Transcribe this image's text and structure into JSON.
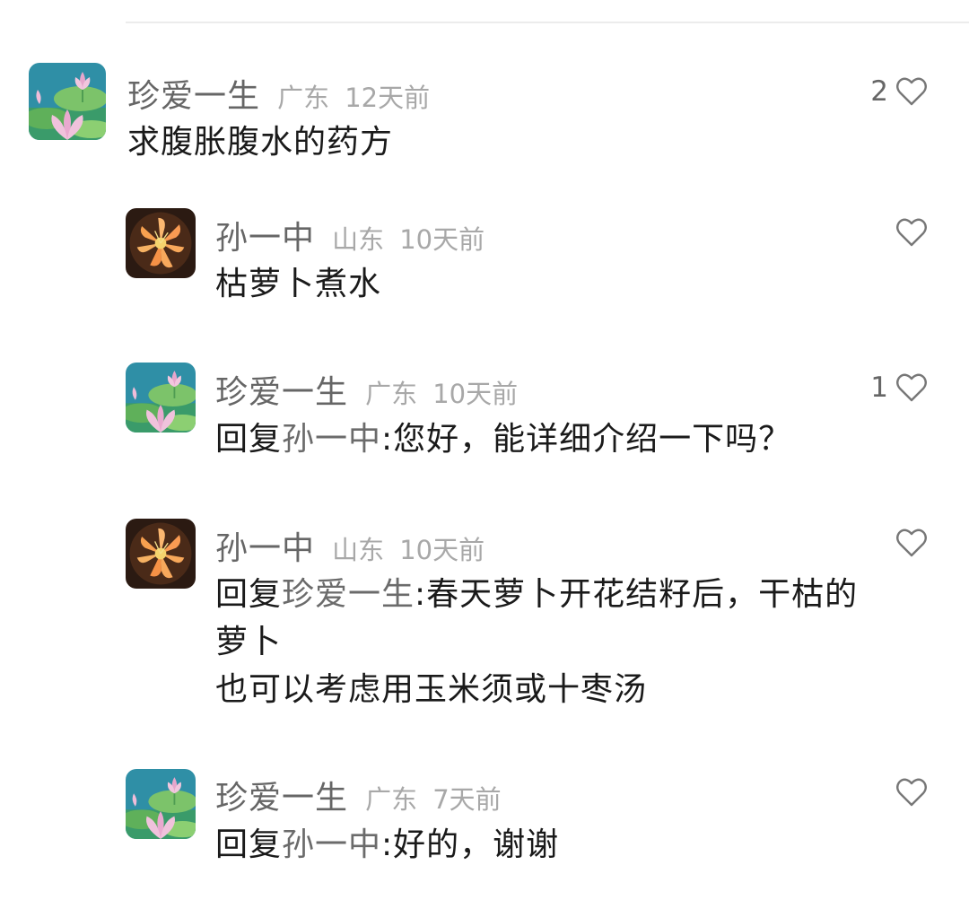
{
  "comments": [
    {
      "username": "珍爱一生",
      "location": "广东",
      "time": "12天前",
      "text": "求腹胀腹水的药方",
      "likes": "2",
      "avatar_icon": "lotus-avatar-icon"
    },
    {
      "username": "孙一中",
      "location": "山东",
      "time": "10天前",
      "text": "枯萝卜煮水",
      "likes": "",
      "avatar_icon": "flower-avatar-icon"
    },
    {
      "username": "珍爱一生",
      "location": "广东",
      "time": "10天前",
      "reply_prefix": "回复",
      "mention": "孙一中",
      "text": ":您好，能详细介绍一下吗？",
      "likes": "1",
      "avatar_icon": "lotus-avatar-icon"
    },
    {
      "username": "孙一中",
      "location": "山东",
      "time": "10天前",
      "reply_prefix": "回复",
      "mention": "珍爱一生",
      "text": ":春天萝卜开花结籽后，干枯的",
      "text_line2": "萝卜",
      "text_line3": "也可以考虑用玉米须或十枣汤",
      "likes": "",
      "avatar_icon": "flower-avatar-icon"
    },
    {
      "username": "珍爱一生",
      "location": "广东",
      "time": "7天前",
      "reply_prefix": "回复",
      "mention": "孙一中",
      "text": ":好的，谢谢",
      "likes": "",
      "avatar_icon": "lotus-avatar-icon"
    }
  ],
  "colors": {
    "username": "#666666",
    "meta": "#a8a8a8",
    "text": "#1a1a1a",
    "mention": "#6b6b6b",
    "heart": "#777777"
  }
}
